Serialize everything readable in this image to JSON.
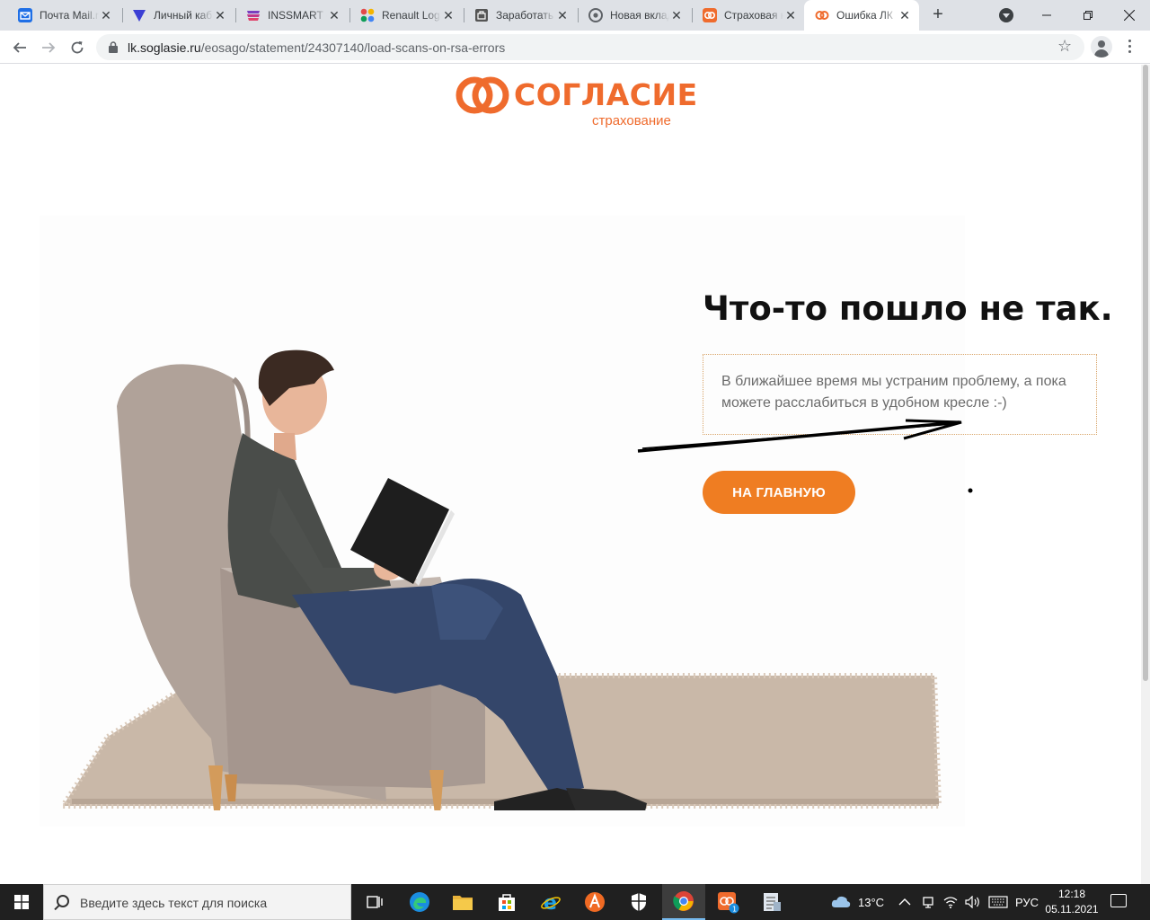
{
  "browser": {
    "tabs": [
      {
        "title": "Почта Mail.ru",
        "favicon_color": "#1f6fe6",
        "favicon": "mail-icon"
      },
      {
        "title": "Личный кабинет",
        "favicon_color": "#3b3fd4",
        "favicon": "shield-icon"
      },
      {
        "title": "INSSMART -",
        "favicon_color": "#c0398c",
        "favicon": "inssmart-icon"
      },
      {
        "title": "Renault Logan",
        "favicon_color": "#e24a4a",
        "favicon": "dots-icon"
      },
      {
        "title": "Заработать",
        "favicon_color": "#555555",
        "favicon": "bag-icon"
      },
      {
        "title": "Новая вкладка",
        "favicon_color": "#5f6368",
        "favicon": "chrome-icon"
      },
      {
        "title": "Страховая компания",
        "favicon_color": "#ef6b2d",
        "favicon": "soglasie-icon"
      },
      {
        "title": "Ошибка ЛК",
        "favicon_color": "#ef6b2d",
        "favicon": "soglasie-icon",
        "active": true
      }
    ],
    "new_tab_label": "+",
    "url_host": "lk.soglasie.ru",
    "url_path": "/eosago/statement/24307140/load-scans-on-rsa-errors"
  },
  "page": {
    "logo_word": "СОГЛАСИЕ",
    "logo_sub": "страхование",
    "error_title": "Что-то пошло не так.",
    "error_message": "В ближайшее время мы устраним проблему, а пока можете расслабиться в удобном кресле :-)",
    "home_button": "НА ГЛАВНУЮ",
    "brand_color": "#ef6b2d",
    "button_color": "#ef7d22"
  },
  "taskbar": {
    "search_placeholder": "Введите здесь текст для поиска",
    "weather": "13°C",
    "language": "РУС",
    "time": "12:18",
    "date": "05.11.2021",
    "pinned_apps": [
      "task-view-icon",
      "edge-icon",
      "file-explorer-icon",
      "store-icon",
      "ie-icon",
      "avast-icon",
      "security-icon",
      "chrome-icon",
      "app-badge-icon",
      "notes-icon"
    ]
  }
}
